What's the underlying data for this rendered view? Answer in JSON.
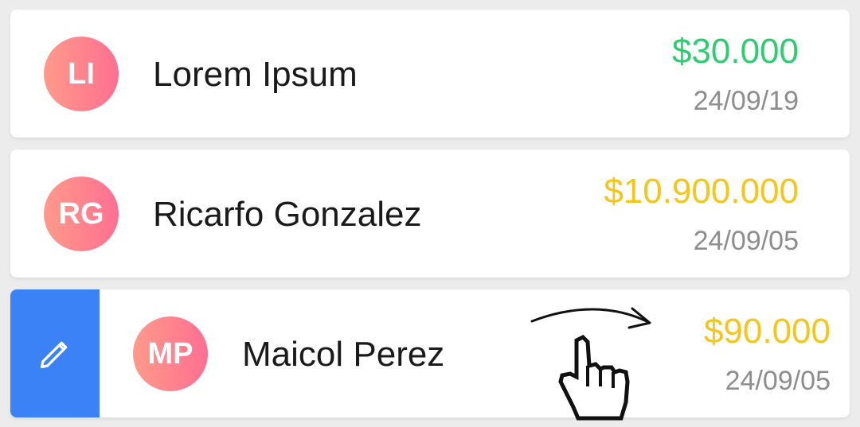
{
  "colors": {
    "positive_amount": "#2ecc71",
    "pending_amount": "#f5c518",
    "edit_action_bg": "#3b82f6",
    "avatar_gradient_start": "#ff9a8b",
    "avatar_gradient_end": "#ff6f91"
  },
  "transactions": [
    {
      "initials": "LI",
      "name": "Lorem Ipsum",
      "amount": "$30.000",
      "date": "24/09/19",
      "amount_color": "#2ecc71"
    },
    {
      "initials": "RG",
      "name": "Ricarfo Gonzalez",
      "amount": "$10.900.000",
      "date": "24/09/05",
      "amount_color": "#f5c518"
    },
    {
      "initials": "MP",
      "name": "Maicol Perez",
      "amount": "$90.000",
      "date": "24/09/05",
      "amount_color": "#f5c518"
    }
  ],
  "swipe_action": {
    "icon": "pencil-icon"
  },
  "gesture_hint": {
    "icon": "hand-pointer-icon",
    "direction": "right"
  }
}
